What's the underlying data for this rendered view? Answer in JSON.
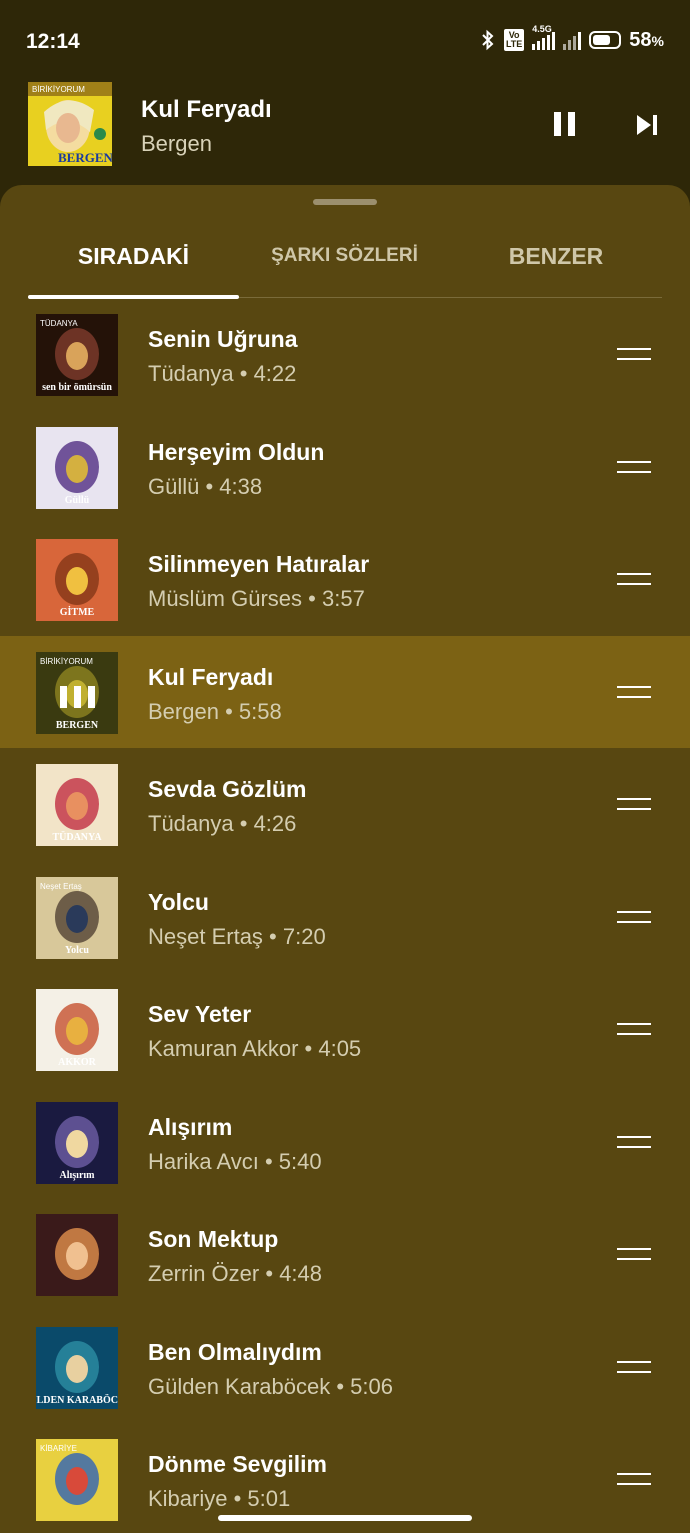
{
  "status_bar": {
    "time": "12:14",
    "network_label": "4.5G",
    "volte_label": "Vo\nLTE",
    "battery_percent": "58",
    "battery_unit": "%"
  },
  "mini_player": {
    "title": "Kul Feryadı",
    "artist": "Bergen",
    "art_caption": "BERGEN",
    "art_top_caption": "BİRİKİYORUM"
  },
  "tabs": [
    {
      "label": "SIRADAKİ",
      "active": true
    },
    {
      "label": "ŞARKI SÖZLERİ",
      "active": false
    },
    {
      "label": "BENZER",
      "active": false
    }
  ],
  "queue": [
    {
      "title": "Senin Uğruna",
      "artist": "Tüdanya",
      "duration": "4:22",
      "playing": false,
      "art_top": "TÜDANYA",
      "art_bottom": "sen bir ömürsün",
      "art_colors": [
        "#241208",
        "#7a3a2a",
        "#d9a35a"
      ]
    },
    {
      "title": "Herşeyim Oldun",
      "artist": "Güllü",
      "duration": "4:38",
      "playing": false,
      "art_top": "",
      "art_bottom": "Güllü",
      "art_colors": [
        "#e8e4f0",
        "#5a3a8a",
        "#d4b040"
      ]
    },
    {
      "title": "Silinmeyen Hatıralar",
      "artist": "Müslüm Gürses",
      "duration": "3:57",
      "playing": false,
      "art_top": "",
      "art_bottom": "GİTME",
      "art_colors": [
        "#d8663a",
        "#8a3a1a",
        "#f0c040"
      ]
    },
    {
      "title": "Kul Feryadı",
      "artist": "Bergen",
      "duration": "5:58",
      "playing": true,
      "art_top": "BİRİKİYORUM",
      "art_bottom": "BERGEN",
      "art_colors": [
        "#3a3a10",
        "#8a8020",
        "#c0b030"
      ]
    },
    {
      "title": "Sevda Gözlüm",
      "artist": "Tüdanya",
      "duration": "4:26",
      "playing": false,
      "art_top": "",
      "art_bottom": "TÜDANYA",
      "art_colors": [
        "#f2e4c8",
        "#c43a4a",
        "#e89060"
      ]
    },
    {
      "title": "Yolcu",
      "artist": "Neşet Ertaş",
      "duration": "7:20",
      "playing": false,
      "art_top": "Neşet Ertaş",
      "art_bottom": "Yolcu",
      "art_colors": [
        "#d8c89a",
        "#5a4a3a",
        "#2a3a5a"
      ]
    },
    {
      "title": "Sev Yeter",
      "artist": "Kamuran Akkor",
      "duration": "4:05",
      "playing": false,
      "art_top": "",
      "art_bottom": "AKKOR",
      "art_colors": [
        "#f4f0e6",
        "#c85a3a",
        "#e8b040"
      ]
    },
    {
      "title": "Alışırım",
      "artist": "Harika Avcı",
      "duration": "5:40",
      "playing": false,
      "art_top": "",
      "art_bottom": "Alışırım",
      "art_colors": [
        "#1a1a40",
        "#6a5aa0",
        "#f0d8a0"
      ]
    },
    {
      "title": "Son Mektup",
      "artist": "Zerrin Özer",
      "duration": "4:48",
      "playing": false,
      "art_top": "",
      "art_bottom": "",
      "art_colors": [
        "#3a1a1a",
        "#d88a4a",
        "#f0c090"
      ]
    },
    {
      "title": "Ben Olmalıydım",
      "artist": "Gülden Karaböcek",
      "duration": "5:06",
      "playing": false,
      "art_top": "",
      "art_bottom": "GÜLDEN KARABÖCEK",
      "art_colors": [
        "#0a4a6a",
        "#2a8aa0",
        "#e8d0a0"
      ]
    },
    {
      "title": "Dönme Sevgilim",
      "artist": "Kibariye",
      "duration": "5:01",
      "playing": false,
      "art_top": "KİBARİYE",
      "art_bottom": "",
      "art_colors": [
        "#e8d040",
        "#3a6ab0",
        "#d84a3a"
      ]
    }
  ],
  "separator": " • ",
  "icons": {
    "pause": "pause-icon",
    "next": "skip-next-icon",
    "drag": "drag-handle-icon",
    "now_playing": "equalizer-icon"
  },
  "colors": {
    "background": "#2e2708",
    "sheet": "#584711",
    "playing_row": "#7c6214",
    "accent_text": "#ffffff",
    "secondary_text": "#d4cdb0"
  }
}
